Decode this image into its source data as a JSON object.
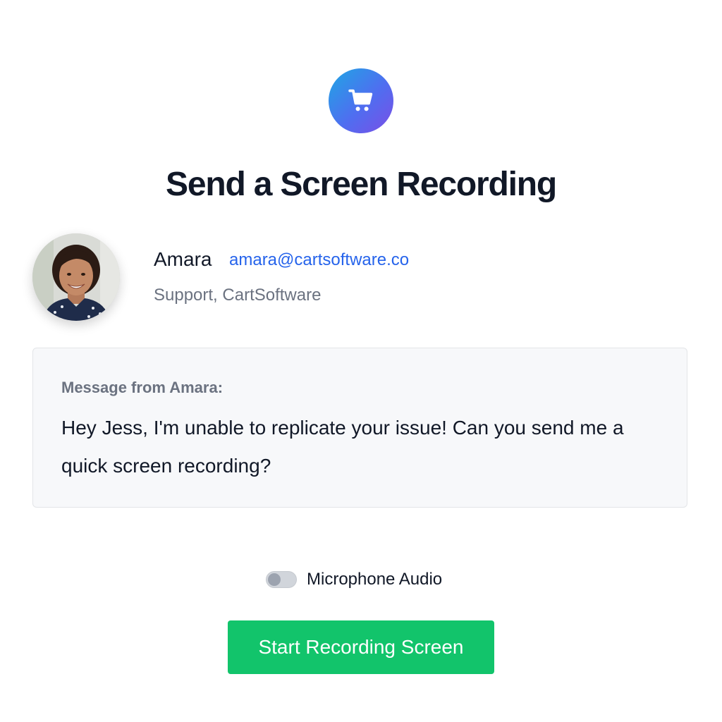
{
  "brand": {
    "logo_icon": "shopping-cart-icon",
    "logo_gradient": [
      "#1ea7e4",
      "#7b4ee6"
    ]
  },
  "page": {
    "title": "Send a Screen Recording"
  },
  "sender": {
    "avatar": "avatar-photo",
    "name": "Amara",
    "email": "amara@cartsoftware.co",
    "role": "Support, CartSoftware"
  },
  "message": {
    "label": "Message from Amara:",
    "text": "Hey Jess, I'm unable to replicate your issue! Can you send me a quick screen recording?"
  },
  "options": {
    "microphone_label": "Microphone Audio",
    "microphone_enabled": false
  },
  "actions": {
    "start_label": "Start Recording Screen",
    "start_color": "#12c46b"
  },
  "colors": {
    "link": "#2563eb",
    "muted": "#6b7280",
    "text": "#111827"
  }
}
